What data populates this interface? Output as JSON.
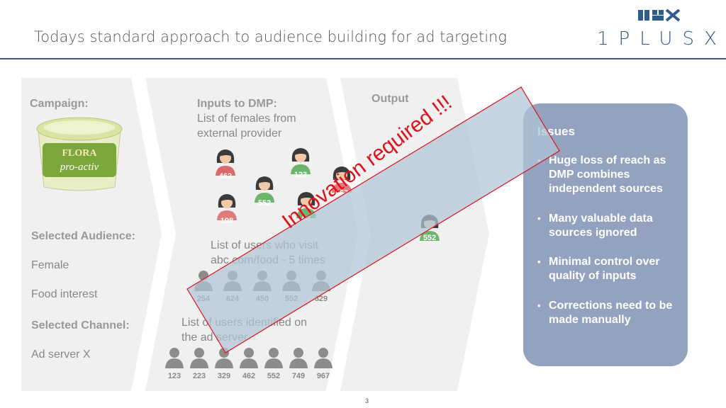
{
  "header": {
    "title": "Todays standard approach to audience building for ad targeting",
    "logo": "1PLUSX"
  },
  "campaign": {
    "label": "Campaign:",
    "product_brand": "FLORA",
    "product_name": "pro-activ"
  },
  "selected_audience": {
    "label": "Selected Audience:",
    "items": [
      "Female",
      "Food interest"
    ]
  },
  "selected_channel": {
    "label": "Selected Channel:",
    "value": "Ad server X"
  },
  "dmp": {
    "title": "Inputs to DMP:",
    "line1": "List of females from",
    "line2": "external provider",
    "female_ids": [
      "462",
      "123",
      "552",
      "967",
      "198",
      "62"
    ],
    "visitors_line1": "List of users who visit",
    "visitors_line2": "abc.com/food - 5 times",
    "visitor_ids": [
      "254",
      "624",
      "450",
      "552",
      "329"
    ],
    "adserver_line1": "List of users identified on",
    "adserver_line2": "the ad server",
    "adserver_ids": [
      "123",
      "223",
      "329",
      "462",
      "552",
      "749",
      "967"
    ]
  },
  "output": {
    "label": "Output",
    "ids": [
      "552"
    ]
  },
  "issues": {
    "title": "Issues",
    "items": [
      "Huge loss of reach as DMP combines independent sources",
      "Many valuable data sources ignored",
      "Minimal control over quality of inputs",
      "Corrections need to be made manually"
    ]
  },
  "stamp": {
    "text": "Innovation required !!!"
  },
  "page_number": "3",
  "colors": {
    "accent": "#3b5f8a",
    "issues_bg": "#93a2bf",
    "stamp_red": "#e1101b",
    "panel_bg": "#f0f0f0"
  }
}
